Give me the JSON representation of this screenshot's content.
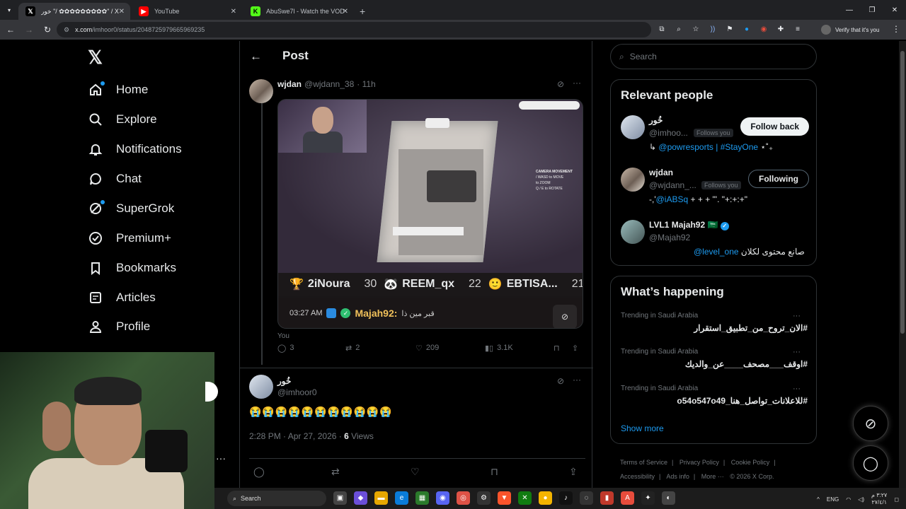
{
  "browser": {
    "tabs": [
      {
        "label": "خور \"/ ✿✿✿✿✿✿✿✿✿\" / X",
        "icon": "x-icon",
        "active": true
      },
      {
        "label": "YouTube",
        "icon": "youtube-icon",
        "active": false
      },
      {
        "label": "AbuSwe7l - Watch the VOD on",
        "icon": "kick-icon",
        "active": false
      }
    ],
    "url_host": "x.com",
    "url_path": "/imhoor0/status/2048725979665969235",
    "profile_label": "Verify that it's you"
  },
  "sidebar": {
    "items": [
      {
        "label": "Home",
        "icon": "home-icon",
        "dot": true
      },
      {
        "label": "Explore",
        "icon": "search-icon",
        "dot": false
      },
      {
        "label": "Notifications",
        "icon": "bell-icon",
        "dot": false
      },
      {
        "label": "Chat",
        "icon": "chat-icon",
        "dot": false
      },
      {
        "label": "SuperGrok",
        "icon": "grok-icon",
        "dot": true
      },
      {
        "label": "Premium+",
        "icon": "premium-icon",
        "dot": false
      },
      {
        "label": "Bookmarks",
        "icon": "bookmark-icon",
        "dot": false
      },
      {
        "label": "Articles",
        "icon": "articles-icon",
        "dot": false
      },
      {
        "label": "Profile",
        "icon": "profile-icon",
        "dot": false
      }
    ]
  },
  "main": {
    "title": "Post",
    "parent_post": {
      "name": "wjdan",
      "handle": "@wjdann_38",
      "time": "· 11h",
      "media": {
        "leaderboard": [
          {
            "name": "2iNoura",
            "score": "30"
          },
          {
            "name": "REEM_qx",
            "score": "22"
          },
          {
            "name": "EBTISA...",
            "score": "21"
          }
        ],
        "chat_time": "03:27 AM",
        "chat_user": "Majah92:",
        "chat_text": "قبر مين ذا",
        "hud_title": "CAMERA MOVEMENT",
        "hud_lines": [
          "/ WASD to MOVE",
          "to ZOOM",
          "Q / E to ROTATE"
        ]
      },
      "you_label": "You",
      "stats": {
        "replies": "3",
        "reposts": "2",
        "likes": "209",
        "views": "3.1K"
      }
    },
    "reply": {
      "name": "خُور",
      "handle": "@imhoor0",
      "text": "😭😭😭😭😭😭😭😭😭😭😭",
      "time": "2:28 PM · Apr 27, 2026 · ",
      "views_count": "6",
      "views_label": " Views"
    }
  },
  "right": {
    "search_placeholder": "Search",
    "relevant_title": "Relevant people",
    "people": [
      {
        "name": "خُور",
        "handle": "@imhoo...",
        "follows_you": "Follows you",
        "button": "Follow back",
        "bio_prefix": "↳ ",
        "bio_link": "@powresports | #StayOne",
        "bio_suffix": " ⋆˚₊"
      },
      {
        "name": "wjdan",
        "handle": "@wjdann_...",
        "follows_you": "Follows you",
        "button": "Following",
        "bio_prefix": "-,'",
        "bio_link": "@iABSq",
        "bio_suffix": " + + + \"'. \"+:+:+\""
      },
      {
        "name": "LVL1 Majah92 🇸🇦",
        "handle": "@Majah92",
        "follows_you": "",
        "button": "",
        "bio_prefix": "",
        "bio_link": "@level_one",
        "bio_suffix": " صانع محتوى لكلان"
      }
    ],
    "happening_title": "What’s happening",
    "trends": [
      {
        "context": "Trending in Saudi Arabia",
        "tag": "#الان_تروح_من_تطبيق_استقرار"
      },
      {
        "context": "Trending in Saudi Arabia",
        "tag": "#اوقف___مصحف____عن_والديك"
      },
      {
        "context": "Trending in Saudi Arabia",
        "tag": "#للاعلانات_تواصل_هنا_o54o547o49"
      }
    ],
    "show_more": "Show more",
    "footer": [
      "Terms of Service",
      "|",
      "Privacy Policy",
      "|",
      "Cookie Policy",
      "|",
      "Accessibility",
      "|",
      "Ads info",
      "|",
      "More ···",
      "© 2026 X Corp."
    ]
  },
  "taskbar": {
    "search_label": "Search",
    "lang": "ENG",
    "time": "٣:٢٧ م",
    "date": "٢٧/٤/١"
  }
}
